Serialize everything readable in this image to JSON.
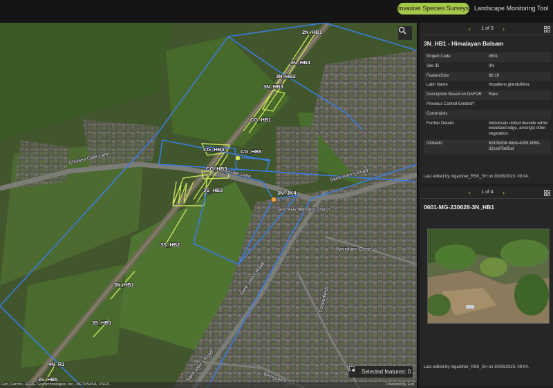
{
  "header": {
    "tabs": [
      {
        "label": "Invasive Species Surveys",
        "active": true
      },
      {
        "label": "Landscape Monitoring Tool",
        "active": false
      }
    ],
    "accent_color": "#a6c94a"
  },
  "map": {
    "road_labels": [
      "Chulsey Gate Lane",
      "Chulsey Gate Lane",
      "Saint John's Road",
      "Saint John's Road",
      "Saint John's Road",
      "Havisham Close",
      "Copperfields",
      "Tennyson Court"
    ],
    "building_label": "Saint Mary Methodist Church",
    "feature_labels": [
      "2N_HB1",
      "3N_HB4",
      "3N_HB2",
      "3N_HB3",
      "CG_HB1",
      "CG_HB4",
      "CG_HB5",
      "CG_HB3",
      "3S_HB3",
      "3S_HB2",
      "3N_HB1",
      "3S_HB1",
      "4N_R1",
      "3S_HB5",
      "3N_JK4"
    ],
    "selected_features": "Selected features: 0",
    "attribution": "Esri, Garmin, HERE, Geotechnologies, Inc., METI/NASA, USGS",
    "powered_by": "Powered by Esri",
    "zoom_icon": "search-icon",
    "boundary_color": "#3a7de0",
    "feature_color": "#c8e05a"
  },
  "popup1": {
    "pager": "1 of 3",
    "title": "3N_HB1 - Himalayan Balsam",
    "rows": [
      {
        "key": "Project Code",
        "value": "0601"
      },
      {
        "key": "Site ID",
        "value": "3N"
      },
      {
        "key": "FeatureSize",
        "value": "86.19"
      },
      {
        "key": "Latin Name",
        "value": "Impatiens glandulifera"
      },
      {
        "key": "Description Based on DAFOR",
        "value": "Rare"
      },
      {
        "key": "Previous Control Evident?",
        "value": ""
      },
      {
        "key": "Constraints",
        "value": ""
      },
      {
        "key": "Further Details",
        "value": "Individuals dotted lineside within woodland edge, amongst other vegetation"
      },
      {
        "key": "GlobalID",
        "value": "6d1592b6-6bbb-4d09-806b-32ce678ef5af"
      }
    ],
    "edited": "Last edited by mgardner_RSK_SH on 30/06/2023, 09:04."
  },
  "popup2": {
    "pager": "1 of 4",
    "title": "0601-MG-230628-3N_HB1",
    "edited": "Last edited by mgardner_RSK_SH on 30/06/2023, 09:04."
  }
}
